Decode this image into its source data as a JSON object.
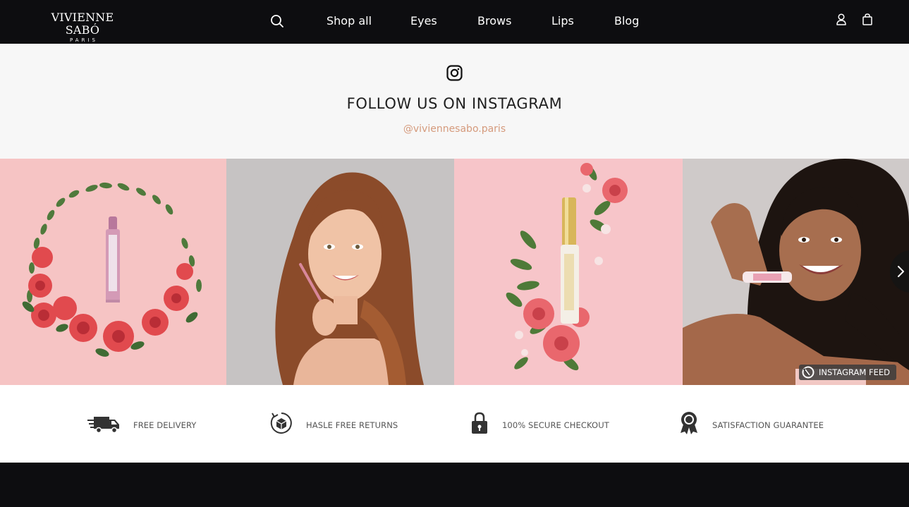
{
  "header": {
    "logo": {
      "name": "VIVIENNE SABÓ",
      "tagline": "PARIS"
    },
    "nav": [
      "Shop all",
      "Eyes",
      "Brows",
      "Lips",
      "Blog"
    ],
    "icons": [
      "search-icon",
      "user-icon",
      "bag-icon"
    ]
  },
  "instagram": {
    "icon": "instagram-icon",
    "title": "FOLLOW US ON INSTAGRAM",
    "handle": "@viviennesabo.paris",
    "feed_badge": "INSTAGRAM FEED",
    "posts": [
      "mascara surrounded by a wreath of red roses on pink",
      "smiling woman holding a brow pencil",
      "eyelash serum tube with pink roses on pink",
      "smiling woman holding a lip gloss"
    ]
  },
  "features": [
    {
      "icon": "delivery-truck-icon",
      "label": "FREE DELIVERY"
    },
    {
      "icon": "returns-box-icon",
      "label": "HASLE FREE RETURNS"
    },
    {
      "icon": "padlock-icon",
      "label": "100% SECURE CHECKOUT"
    },
    {
      "icon": "award-ribbon-icon",
      "label": "SATISFACTION GUARANTEE"
    }
  ],
  "colors": {
    "header_bg": "#0d0d10",
    "section_bg": "#f7f7f7",
    "handle": "#d59a7c",
    "tile_pink": "#f6c3c3",
    "tile_grey": "#c7c4c4"
  }
}
